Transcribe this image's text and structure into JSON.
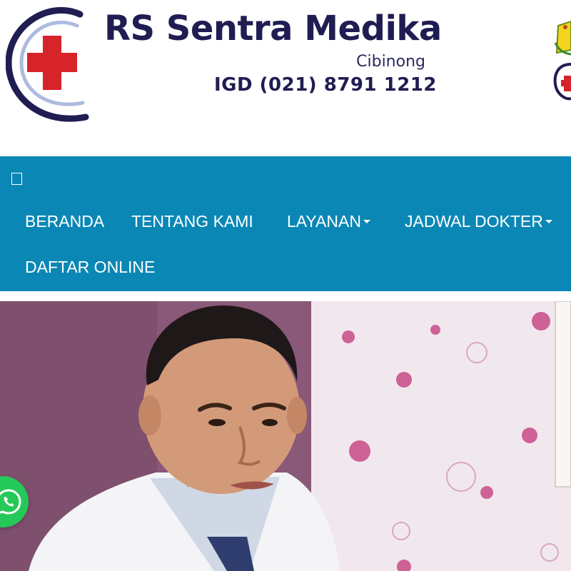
{
  "header": {
    "hospital_name": "RS Sentra Medika",
    "location": "Cibinong",
    "emergency_line": "IGD (021) 8791 1212",
    "logo_icon": "red-cross-icon",
    "colors": {
      "brand_navy": "#1f1d52",
      "cross_red": "#d7232a"
    }
  },
  "nav": {
    "toggle_icon": "menu-toggle-icon",
    "items": [
      {
        "label": "BERANDA",
        "dropdown": false
      },
      {
        "label": "TENTANG KAMI",
        "dropdown": false
      },
      {
        "label": "LAYANAN",
        "dropdown": true
      },
      {
        "label": "JADWAL DOKTER",
        "dropdown": true
      },
      {
        "label": "DAFTAR ONLINE",
        "dropdown": false
      }
    ],
    "colors": {
      "background": "#0b87b5",
      "text": "#ffffff"
    }
  },
  "hero": {
    "image": "doctor-portrait"
  },
  "floating": {
    "whatsapp_icon": "whatsapp-icon",
    "color": "#25c95a"
  }
}
